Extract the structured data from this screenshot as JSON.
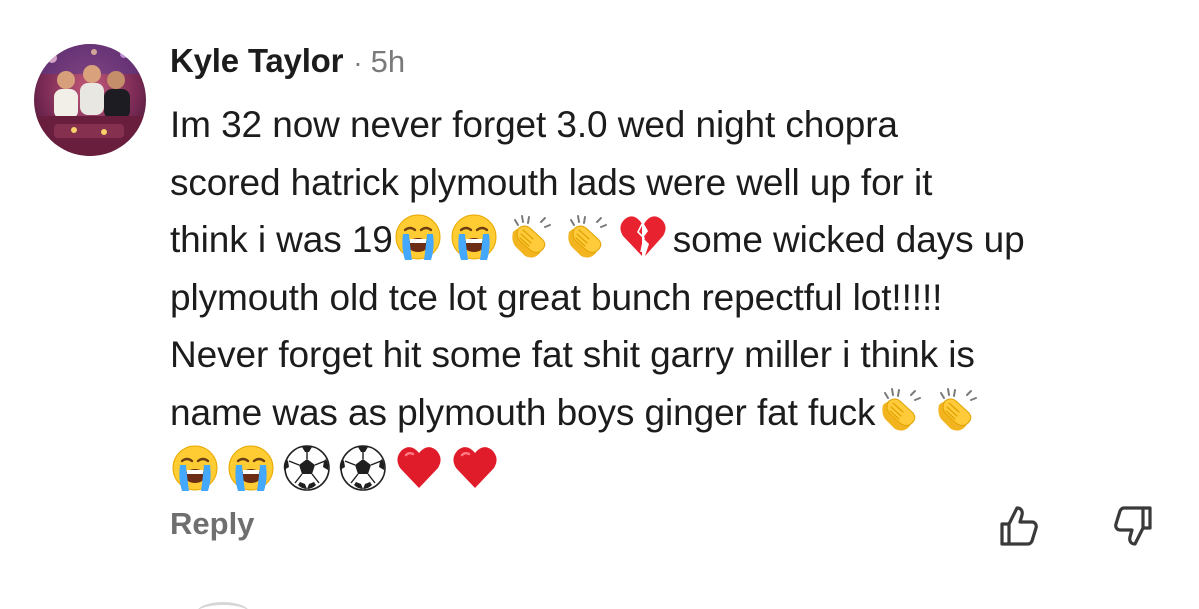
{
  "comment": {
    "author": "Kyle Taylor",
    "separator": "·",
    "time": "5h",
    "lines": [
      [
        {
          "t": "text",
          "v": "Im 32 now never forget 3.0 wed night chopra"
        }
      ],
      [
        {
          "t": "text",
          "v": "scored hatrick plymouth lads were well up for it"
        }
      ],
      [
        {
          "t": "text",
          "v": "think i was 19"
        },
        {
          "t": "emoji",
          "v": "crying-face"
        },
        {
          "t": "emoji",
          "v": "crying-face"
        },
        {
          "t": "emoji",
          "v": "clapping-hands"
        },
        {
          "t": "emoji",
          "v": "clapping-hands"
        },
        {
          "t": "emoji",
          "v": "broken-heart"
        },
        {
          "t": "text",
          "v": "some wicked days up"
        }
      ],
      [
        {
          "t": "text",
          "v": "plymouth old tce lot great bunch repectful lot!!!!!"
        }
      ],
      [
        {
          "t": "text",
          "v": "Never forget hit some fat shit garry miller i think is"
        }
      ],
      [
        {
          "t": "text",
          "v": "name was as plymouth boys ginger fat fuck"
        },
        {
          "t": "emoji",
          "v": "clapping-hands"
        },
        {
          "t": "emoji",
          "v": "clapping-hands"
        }
      ],
      [
        {
          "t": "emoji",
          "v": "crying-face"
        },
        {
          "t": "emoji",
          "v": "crying-face"
        },
        {
          "t": "emoji",
          "v": "soccer-ball"
        },
        {
          "t": "emoji",
          "v": "soccer-ball"
        },
        {
          "t": "emoji",
          "v": "red-heart"
        },
        {
          "t": "emoji",
          "v": "red-heart"
        }
      ]
    ]
  },
  "actions": {
    "reply_label": "Reply",
    "upvote_icon": "thumbs-up-icon",
    "downvote_icon": "thumbs-down-icon"
  },
  "colors": {
    "text": "#1c1c1c",
    "muted": "#7a7a7a",
    "reply": "#6f6f6f",
    "background": "#ffffff"
  }
}
